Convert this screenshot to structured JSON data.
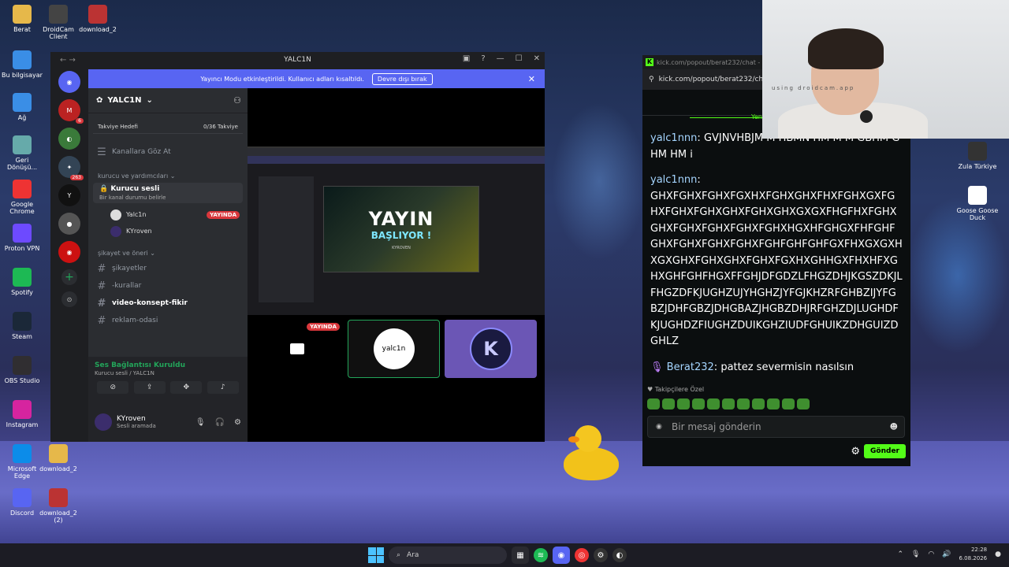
{
  "desktop": {
    "icons_left": [
      {
        "label": "Berat",
        "icon": "folder-icon",
        "color": "#e6b84a"
      },
      {
        "label": "DroidCam Client",
        "icon": "droidcam-icon",
        "color": "#444"
      },
      {
        "label": "download_2",
        "icon": "archive-icon",
        "color": "#b33"
      },
      {
        "label": "Bu bilgisayar",
        "icon": "computer-icon",
        "color": "#3a8ee6"
      },
      {
        "label": "Ağ",
        "icon": "network-icon",
        "color": "#3a8ee6"
      },
      {
        "label": "Geri Dönüşü...",
        "icon": "recycle-bin-icon",
        "color": "#6aa"
      },
      {
        "label": "Google Chrome",
        "icon": "chrome-icon",
        "color": "#e33"
      },
      {
        "label": "Proton VPN",
        "icon": "vpn-icon",
        "color": "#6d4aff"
      },
      {
        "label": "Spotify",
        "icon": "spotify-icon",
        "color": "#1db954"
      },
      {
        "label": "Steam",
        "icon": "steam-icon",
        "color": "#1b2838"
      },
      {
        "label": "OBS Studio",
        "icon": "obs-icon",
        "color": "#302e31"
      },
      {
        "label": "Instagram",
        "icon": "instagram-icon",
        "color": "#d6249f"
      },
      {
        "label": "Microsoft Edge",
        "icon": "edge-icon",
        "color": "#0c8ce9"
      },
      {
        "label": "download_2",
        "icon": "folder-icon",
        "color": "#e6b84a"
      },
      {
        "label": "Discord",
        "icon": "discord-icon",
        "color": "#5865f2"
      },
      {
        "label": "download_2 (2)",
        "icon": "archive-icon",
        "color": "#b33"
      }
    ],
    "icons_right": [
      {
        "label": "Zula Türkiye",
        "icon": "zula-icon",
        "color": "#333"
      },
      {
        "label": "Goose Goose Duck",
        "icon": "goose-icon",
        "color": "#fff"
      }
    ]
  },
  "discord": {
    "window_title": "YALC1N",
    "banner_text": "Yayıncı Modu etkinleştirildi. Kullanıcı adları kısaltıldı.",
    "banner_button": "Devre dışı bırak",
    "server_name": "YALC1N",
    "boost_label": "Takviye Hedefi",
    "boost_count": "0/36 Takviye",
    "browse_channels": "Kanallara Göz At",
    "category1": "kurucu ve yardımcıları",
    "voice_channel": "Kurucu sesli",
    "voice_status": "Bir kanal durumu belirle",
    "voice_users": [
      {
        "name": "Yalc1n",
        "live": "YAYINDA"
      },
      {
        "name": "KYroven",
        "live": ""
      }
    ],
    "category2": "şikayet ve öneri",
    "text_channels": [
      "şikayetler",
      "-kurallar",
      "video-konsept-fikir",
      "reklam-odasi"
    ],
    "voice_connected": "Ses Bağlantısı Kuruldu",
    "voice_connected_sub": "Kurucu sesli / YALC1N",
    "user_name": "KYroven",
    "user_status": "Sesli aramada",
    "tile_live_badge": "YAYINDA",
    "tile_avatar_text": "yalc1n",
    "preview_title": "YAYIN",
    "preview_subtitle": "BAŞLIYOR !",
    "preview_caption": "KYROVEN",
    "guild_badge": "263"
  },
  "kick": {
    "tab_title": "kick.com/popout/berat232/chat - Goo",
    "url": "kick.com/popout/berat232/chat",
    "messages": [
      {
        "user": "yalc1nnn",
        "text": "GVJNVHBJM M HBMN HM M M GBHM GHM HM i"
      },
      {
        "user": "yalc1nnn",
        "text": "GHXFGHXFGHXFGXHXFGHXGHXFHXFGHXGXFGHXFGHXFGHXGHXFGHXGHXGXGXFHGFHXFGHXGHXFGHXFGHXFGHXFGHXHGXHFGHGXFHFGHFGHXFGHXFGHXFGHXFGHFGHFGHFGXFHXGXGXHXGXGHXFGHXGHXFGHXFGXHXGHHGXFHXHFXGHXGHFGHFHGXFFGHJDFGDZLFHGZDHJKGSZDKJLFHGZDFKJUGHZUJYHGHZJYFGJKHZRFGHBZIJYFGBZJDHFGBZJDHGBAZJHGBZDHJRFGHZDJLUGHDFKJUGHDZFIUGHZDUIKGHZIUDFGHUIKZDHGUIZDGHLZ"
      },
      {
        "user": "Berat232",
        "text": "pattez severmisin nasılsın"
      }
    ],
    "followers_label": "Takipçilere Özel",
    "input_placeholder": "Bir mesaj gönderin",
    "send_label": "Gönder",
    "top_label": "Yen"
  },
  "webcam": {
    "caption": "using droidcam.app"
  },
  "taskbar": {
    "search_label": "Ara",
    "time": "22:28",
    "date": "6.08.2026"
  }
}
